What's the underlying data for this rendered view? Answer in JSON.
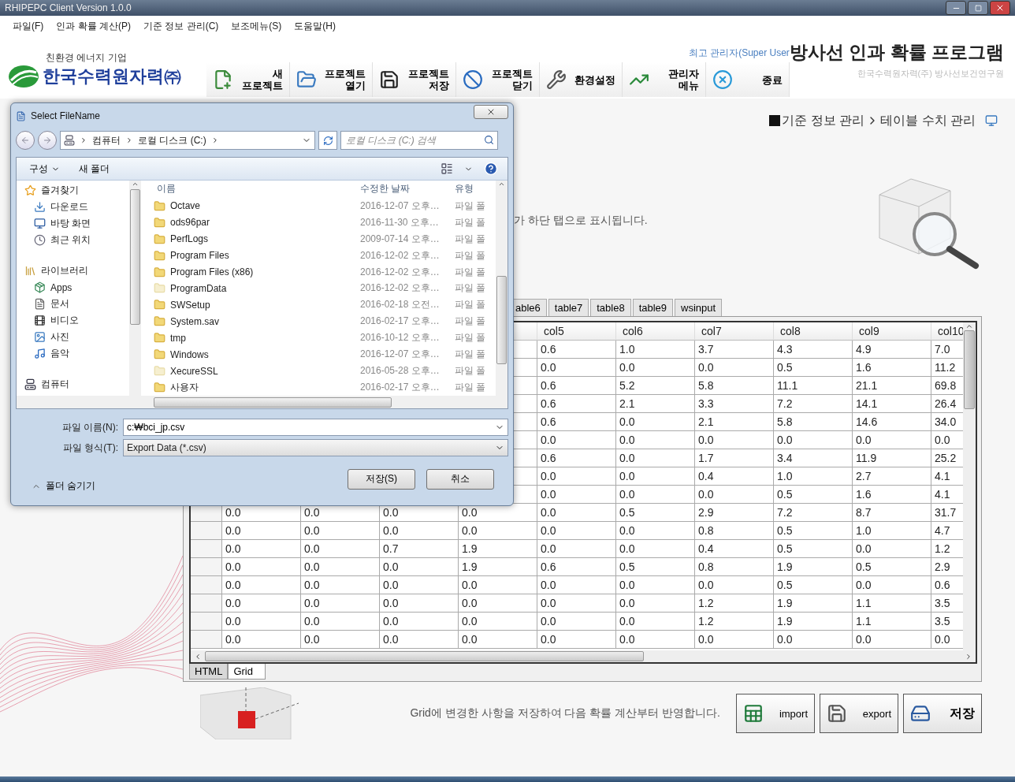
{
  "window": {
    "title": "RHIPEPC Client Version 1.0.0"
  },
  "menu": [
    "파일(F)",
    "인과 확률 계산(P)",
    "기준 정보 관리(C)",
    "보조메뉴(S)",
    "도움말(H)"
  ],
  "logo": {
    "tagline": "친환경 에너지 기업",
    "name": "한국수력원자력㈜"
  },
  "user": "최고 관리자(Super User",
  "toolbar": [
    {
      "lines": [
        "새",
        "프로젝트"
      ],
      "kind": "new"
    },
    {
      "lines": [
        "프로젝트",
        "열기"
      ],
      "kind": "open"
    },
    {
      "lines": [
        "프로젝트",
        "저장"
      ],
      "kind": "save"
    },
    {
      "lines": [
        "프로젝트",
        "닫기"
      ],
      "kind": "close"
    },
    {
      "lines": [
        "환경설정"
      ],
      "kind": "settings"
    },
    {
      "lines": [
        "관리자",
        "메뉴"
      ],
      "kind": "admin"
    },
    {
      "lines": [
        "종료"
      ],
      "kind": "exit"
    }
  ],
  "app_title": "방사선 인과 확률 프로그램",
  "org": "한국수력원자력(주) 방사선보건연구원",
  "breadcrumb": [
    "기준 정보 관리",
    "테이블 수치 관리"
  ],
  "description": "가 하단 탭으로 표시됩니다.",
  "table_tabs": [
    {
      "label": "able6",
      "selected": false
    },
    {
      "label": "table7",
      "selected": false
    },
    {
      "label": "table8",
      "selected": false
    },
    {
      "label": "table9",
      "selected": false
    },
    {
      "label": "wsinput",
      "selected": false
    }
  ],
  "grid": {
    "columns": [
      "col5",
      "col6",
      "col7",
      "col8",
      "col9",
      "col10"
    ],
    "rows": [
      {
        "cells": [
          "0.6",
          "1.0",
          "3.7",
          "4.3",
          "4.9",
          "7.0"
        ]
      },
      {
        "cells": [
          "0.0",
          "0.0",
          "0.0",
          "0.5",
          "1.6",
          "11.2"
        ]
      },
      {
        "cells": [
          "0.6",
          "5.2",
          "5.8",
          "11.1",
          "21.1",
          "69.8"
        ]
      },
      {
        "cells": [
          "0.6",
          "2.1",
          "3.3",
          "7.2",
          "14.1",
          "26.4"
        ]
      },
      {
        "cells": [
          "0.6",
          "0.0",
          "2.1",
          "5.8",
          "14.6",
          "34.0"
        ]
      },
      {
        "cells": [
          "0.0",
          "0.0",
          "0.0",
          "0.0",
          "0.0",
          "0.0"
        ]
      },
      {
        "cells": [
          "0.6",
          "0.0",
          "1.7",
          "3.4",
          "11.9",
          "25.2"
        ]
      },
      {
        "cells": [
          "0.0",
          "0.0",
          "0.4",
          "1.0",
          "2.7",
          "4.1"
        ]
      },
      {
        "cells": [
          "0.0",
          "0.0",
          "0.0",
          "0.5",
          "1.6",
          "4.1"
        ]
      },
      {
        "cells": [
          "0.0",
          "0.0",
          "0.0",
          "0.0",
          "0.0",
          "0.5",
          "2.9",
          "7.2",
          "8.7",
          "31.7"
        ]
      },
      {
        "cells": [
          "0.0",
          "0.0",
          "0.0",
          "0.0",
          "0.0",
          "0.0",
          "0.8",
          "0.5",
          "1.0",
          "4.7"
        ]
      },
      {
        "cells": [
          "0.0",
          "0.0",
          "0.7",
          "1.9",
          "0.0",
          "0.0",
          "0.4",
          "0.5",
          "0.0",
          "1.2"
        ]
      },
      {
        "cells": [
          "0.0",
          "0.0",
          "0.0",
          "1.9",
          "0.6",
          "0.5",
          "0.8",
          "1.9",
          "0.5",
          "2.9"
        ]
      },
      {
        "cells": [
          "0.0",
          "0.0",
          "0.0",
          "0.0",
          "0.0",
          "0.0",
          "0.0",
          "0.5",
          "0.0",
          "0.6"
        ]
      },
      {
        "cells": [
          "0.0",
          "0.0",
          "0.0",
          "0.0",
          "0.0",
          "0.0",
          "1.2",
          "1.9",
          "1.1",
          "3.5"
        ]
      },
      {
        "cells": [
          "0.0",
          "0.0",
          "0.0",
          "0.0",
          "0.0",
          "0.0",
          "1.2",
          "1.9",
          "1.1",
          "3.5"
        ]
      },
      {
        "cells": [
          "0.0",
          "0.0",
          "0.0",
          "0.0",
          "0.0",
          "0.0",
          "0.0",
          "0.0",
          "0.0",
          "0.0"
        ]
      }
    ]
  },
  "view_tabs": [
    {
      "label": "HTML",
      "selected": false
    },
    {
      "label": "Grid",
      "selected": true
    }
  ],
  "footer": {
    "note": "Grid에 변경한 사항을 저장하여 다음 확률 계산부터 반영합니다.",
    "buttons": [
      {
        "label": "import",
        "kind": "excel"
      },
      {
        "label": "export",
        "kind": "disk"
      },
      {
        "label": "저장",
        "kind": "save"
      }
    ]
  },
  "dialog": {
    "title": "Select FileName",
    "path": [
      "컴퓨터",
      "로컬 디스크 (C:)"
    ],
    "search_placeholder": "로컬 디스크 (C:) 검색",
    "organize": "구성",
    "new_folder": "새 폴더",
    "nav": [
      {
        "label": "즐겨찾기",
        "kind": "star",
        "children": [
          {
            "label": "다운로드",
            "kind": "download"
          },
          {
            "label": "바탕 화면",
            "kind": "desktop"
          },
          {
            "label": "최근 위치",
            "kind": "recent"
          }
        ]
      },
      {
        "label": "라이브러리",
        "kind": "library",
        "children": [
          {
            "label": "Apps",
            "kind": "apps"
          },
          {
            "label": "문서",
            "kind": "document"
          },
          {
            "label": "비디오",
            "kind": "video"
          },
          {
            "label": "사진",
            "kind": "picture"
          },
          {
            "label": "음악",
            "kind": "music"
          }
        ]
      },
      {
        "label": "컴퓨터",
        "kind": "computer"
      }
    ],
    "columns": [
      "이름",
      "수정한 날짜",
      "유형"
    ],
    "files": [
      {
        "name": "Octave",
        "date": "2016-12-07 오후…",
        "type": "파일 폴",
        "hidden": false
      },
      {
        "name": "ods96par",
        "date": "2016-11-30 오후…",
        "type": "파일 폴",
        "hidden": false
      },
      {
        "name": "PerfLogs",
        "date": "2009-07-14 오후…",
        "type": "파일 폴",
        "hidden": false
      },
      {
        "name": "Program Files",
        "date": "2016-12-02 오후…",
        "type": "파일 폴",
        "hidden": false
      },
      {
        "name": "Program Files (x86)",
        "date": "2016-12-02 오후…",
        "type": "파일 폴",
        "hidden": false
      },
      {
        "name": "ProgramData",
        "date": "2016-12-02 오후…",
        "type": "파일 폴",
        "hidden": true
      },
      {
        "name": "SWSetup",
        "date": "2016-02-18 오전…",
        "type": "파일 폴",
        "hidden": false
      },
      {
        "name": "System.sav",
        "date": "2016-02-17 오후…",
        "type": "파일 폴",
        "hidden": false
      },
      {
        "name": "tmp",
        "date": "2016-10-12 오후…",
        "type": "파일 폴",
        "hidden": false
      },
      {
        "name": "Windows",
        "date": "2016-12-07 오후…",
        "type": "파일 폴",
        "hidden": false
      },
      {
        "name": "XecureSSL",
        "date": "2016-05-28 오후…",
        "type": "파일 폴",
        "hidden": true
      },
      {
        "name": "사용자",
        "date": "2016-02-17 오후…",
        "type": "파일 폴",
        "hidden": false
      }
    ],
    "file_name": {
      "label": "파일 이름(N):",
      "value": "c:₩bci_jp.csv"
    },
    "file_type": {
      "label": "파일 형식(T):",
      "value": "Export Data (*.csv)"
    },
    "hide_folders": "폴더 숨기기",
    "buttons": [
      "저장(S)",
      "취소"
    ]
  }
}
